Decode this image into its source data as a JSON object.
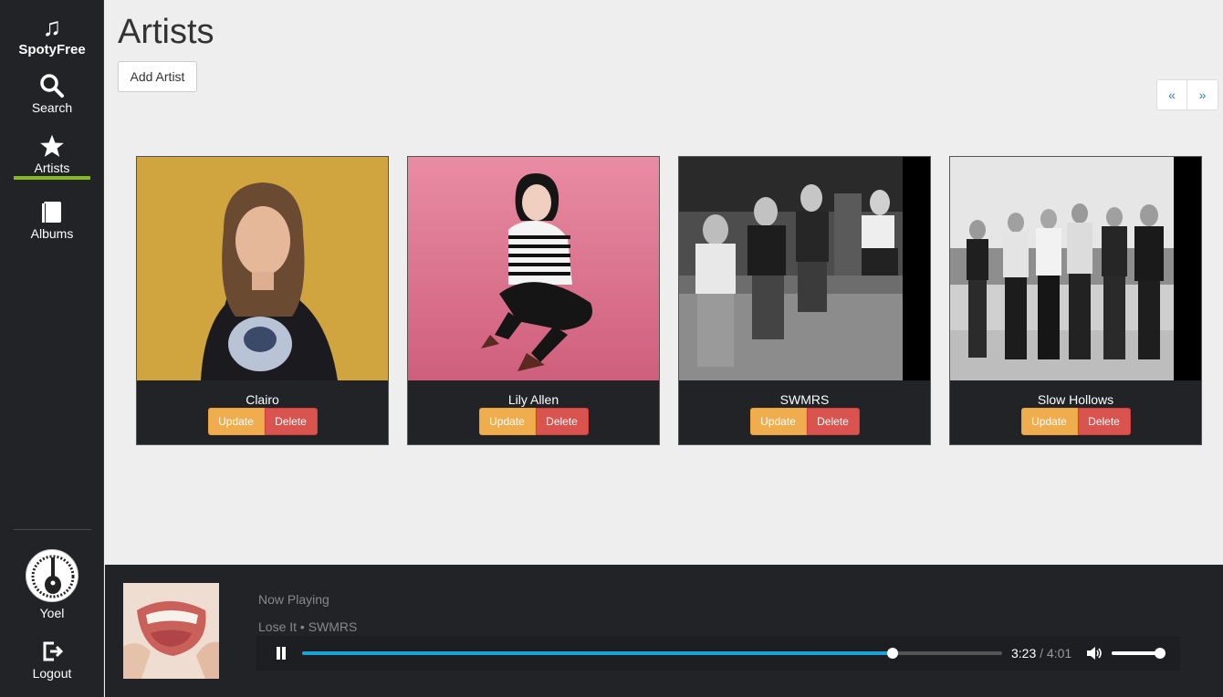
{
  "app": {
    "brand": "SpotyFree"
  },
  "sidebar": {
    "items": [
      {
        "label": "Search",
        "icon": "search-icon"
      },
      {
        "label": "Artists",
        "icon": "star-icon",
        "active": true
      },
      {
        "label": "Albums",
        "icon": "album-icon"
      }
    ],
    "user": {
      "name": "Yoel"
    },
    "logout_label": "Logout"
  },
  "main": {
    "title": "Artists",
    "add_label": "Add Artist",
    "pager": {
      "prev": "«",
      "next": "»"
    },
    "artists": [
      {
        "name": "Clairo",
        "update_label": "Update",
        "delete_label": "Delete"
      },
      {
        "name": "Lily Allen",
        "update_label": "Update",
        "delete_label": "Delete"
      },
      {
        "name": "SWMRS",
        "update_label": "Update",
        "delete_label": "Delete"
      },
      {
        "name": "Slow Hollows",
        "update_label": "Update",
        "delete_label": "Delete"
      }
    ]
  },
  "player": {
    "now_playing_label": "Now Playing",
    "track": "Lose It • SWMRS",
    "current_time": "3:23",
    "duration": "/ 4:01",
    "progress": 0.843,
    "volume": 1.0
  },
  "colors": {
    "accent": "#84b91f",
    "progress": "#1aa3d9",
    "update": "#f0ad4e",
    "delete": "#d9534f"
  }
}
